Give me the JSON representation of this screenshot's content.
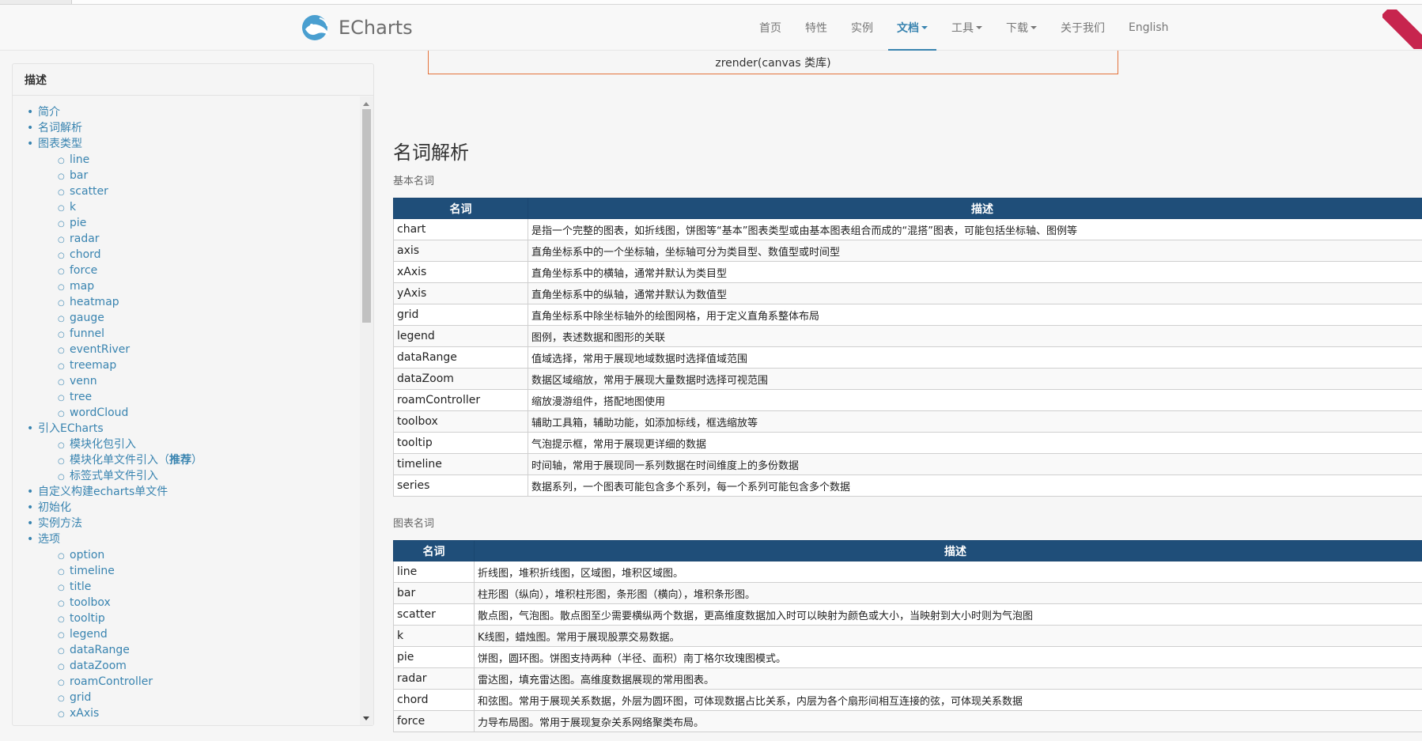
{
  "navbar": {
    "brand": "ECharts",
    "items": [
      {
        "label": "首页",
        "active": false,
        "dropdown": false
      },
      {
        "label": "特性",
        "active": false,
        "dropdown": false
      },
      {
        "label": "实例",
        "active": false,
        "dropdown": false
      },
      {
        "label": "文档",
        "active": true,
        "dropdown": true
      },
      {
        "label": "工具",
        "active": false,
        "dropdown": true
      },
      {
        "label": "下载",
        "active": false,
        "dropdown": true
      },
      {
        "label": "关于我们",
        "active": false,
        "dropdown": false
      },
      {
        "label": "English",
        "active": false,
        "dropdown": false
      }
    ],
    "accent_color": "#3984b0"
  },
  "sidebar": {
    "title": "描述",
    "items": [
      {
        "label": "简介",
        "level": 1
      },
      {
        "label": "名词解析",
        "level": 1
      },
      {
        "label": "图表类型",
        "level": 1
      },
      {
        "label": "line",
        "level": 2
      },
      {
        "label": "bar",
        "level": 2
      },
      {
        "label": "scatter",
        "level": 2
      },
      {
        "label": "k",
        "level": 2
      },
      {
        "label": "pie",
        "level": 2
      },
      {
        "label": "radar",
        "level": 2
      },
      {
        "label": "chord",
        "level": 2
      },
      {
        "label": "force",
        "level": 2
      },
      {
        "label": "map",
        "level": 2
      },
      {
        "label": "heatmap",
        "level": 2
      },
      {
        "label": "gauge",
        "level": 2
      },
      {
        "label": "funnel",
        "level": 2
      },
      {
        "label": "eventRiver",
        "level": 2
      },
      {
        "label": "treemap",
        "level": 2
      },
      {
        "label": "venn",
        "level": 2
      },
      {
        "label": "tree",
        "level": 2
      },
      {
        "label": "wordCloud",
        "level": 2
      },
      {
        "label": "引入ECharts",
        "level": 1
      },
      {
        "label": "模块化包引入",
        "level": 2
      },
      {
        "label": "模块化单文件引入（",
        "bold": "推荐",
        "suffix": "）",
        "level": 2
      },
      {
        "label": "标签式单文件引入",
        "level": 2
      },
      {
        "label": "自定义构建echarts单文件",
        "level": 1
      },
      {
        "label": "初始化",
        "level": 1
      },
      {
        "label": "实例方法",
        "level": 1
      },
      {
        "label": "选项",
        "level": 1
      },
      {
        "label": "option",
        "level": 2
      },
      {
        "label": "timeline",
        "level": 2
      },
      {
        "label": "title",
        "level": 2
      },
      {
        "label": "toolbox",
        "level": 2
      },
      {
        "label": "tooltip",
        "level": 2
      },
      {
        "label": "legend",
        "level": 2
      },
      {
        "label": "dataRange",
        "level": 2
      },
      {
        "label": "dataZoom",
        "level": 2
      },
      {
        "label": "roamController",
        "level": 2
      },
      {
        "label": "grid",
        "level": 2
      },
      {
        "label": "xAxis",
        "level": 2
      }
    ]
  },
  "main": {
    "zrender_label": "zrender(canvas 类库)",
    "section_title": "名词解析",
    "basic_terms": {
      "label": "基本名词",
      "headers": [
        "名词",
        "描述"
      ],
      "rows": [
        [
          "chart",
          "是指一个完整的图表，如折线图，饼图等“基本”图表类型或由基本图表组合而成的“混搭”图表，可能包括坐标轴、图例等"
        ],
        [
          "axis",
          "直角坐标系中的一个坐标轴，坐标轴可分为类目型、数值型或时间型"
        ],
        [
          "xAxis",
          "直角坐标系中的横轴，通常并默认为类目型"
        ],
        [
          "yAxis",
          "直角坐标系中的纵轴，通常并默认为数值型"
        ],
        [
          "grid",
          "直角坐标系中除坐标轴外的绘图网格，用于定义直角系整体布局"
        ],
        [
          "legend",
          "图例，表述数据和图形的关联"
        ],
        [
          "dataRange",
          "值域选择，常用于展现地域数据时选择值域范围"
        ],
        [
          "dataZoom",
          "数据区域缩放，常用于展现大量数据时选择可视范围"
        ],
        [
          "roamController",
          "缩放漫游组件，搭配地图使用"
        ],
        [
          "toolbox",
          "辅助工具箱，辅助功能，如添加标线，框选缩放等"
        ],
        [
          "tooltip",
          "气泡提示框，常用于展现更详细的数据"
        ],
        [
          "timeline",
          "时间轴，常用于展现同一系列数据在时间维度上的多份数据"
        ],
        [
          "series",
          "数据系列，一个图表可能包含多个系列，每一个系列可能包含多个数据"
        ]
      ]
    },
    "chart_terms": {
      "label": "图表名词",
      "headers": [
        "名词",
        "描述"
      ],
      "rows": [
        [
          "line",
          "折线图，堆积折线图，区域图，堆积区域图。"
        ],
        [
          "bar",
          "柱形图（纵向），堆积柱形图，条形图（横向），堆积条形图。"
        ],
        [
          "scatter",
          "散点图，气泡图。散点图至少需要横纵两个数据，更高维度数据加入时可以映射为颜色或大小，当映射到大小时则为气泡图"
        ],
        [
          "k",
          "K线图，蜡烛图。常用于展现股票交易数据。"
        ],
        [
          "pie",
          "饼图，圆环图。饼图支持两种（半径、面积）南丁格尔玫瑰图模式。"
        ],
        [
          "radar",
          "雷达图，填充雷达图。高维度数据展现的常用图表。"
        ],
        [
          "chord",
          "和弦图。常用于展现关系数据，外层为圆环图，可体现数据占比关系，内层为各个扇形间相互连接的弦，可体现关系数据"
        ],
        [
          "force",
          "力导布局图。常用于展现复杂关系网络聚类布局。"
        ]
      ]
    }
  }
}
